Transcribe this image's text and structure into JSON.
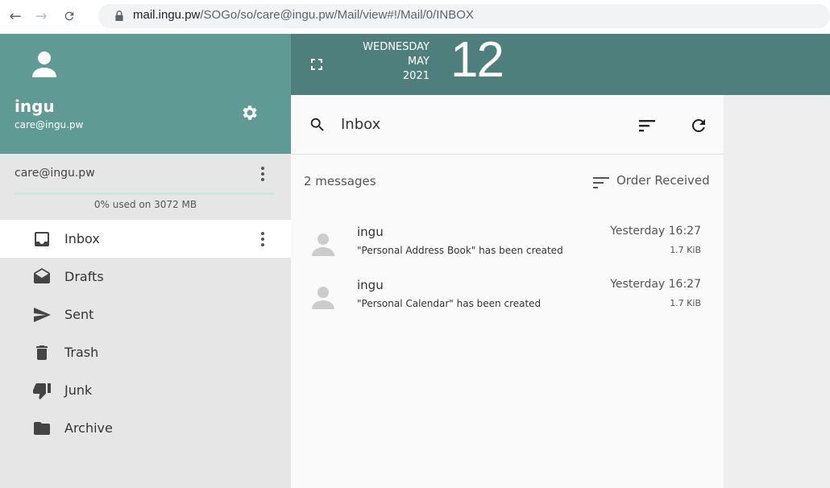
{
  "browser": {
    "url_host": "mail.ingu.pw",
    "url_path": "/SOGo/so/care@ingu.pw/Mail/view#!/Mail/0/INBOX"
  },
  "user": {
    "name": "ingu",
    "email": "care@ingu.pw"
  },
  "account": {
    "label": "care@ingu.pw",
    "quota_text": "0% used on 3072 MB",
    "quota_fraction": 0
  },
  "folders": [
    {
      "label": "Inbox",
      "icon": "inbox-icon",
      "active": true
    },
    {
      "label": "Drafts",
      "icon": "drafts-icon",
      "active": false
    },
    {
      "label": "Sent",
      "icon": "send-icon",
      "active": false
    },
    {
      "label": "Trash",
      "icon": "trash-icon",
      "active": false
    },
    {
      "label": "Junk",
      "icon": "thumb-down-icon",
      "active": false
    },
    {
      "label": "Archive",
      "icon": "folder-icon",
      "active": false
    }
  ],
  "date": {
    "weekday": "WEDNESDAY",
    "month": "MAY",
    "year": "2021",
    "day": "12"
  },
  "list": {
    "folder_title": "Inbox",
    "count_text": "2 messages",
    "order_label": "Order Received",
    "messages": [
      {
        "from": "ingu",
        "subject": "\"Personal Address Book\" has been created",
        "date": "Yesterday 16:27",
        "size": "1.7 KiB"
      },
      {
        "from": "ingu",
        "subject": "\"Personal Calendar\" has been created",
        "date": "Yesterday 16:27",
        "size": "1.7 KiB"
      }
    ]
  },
  "colors": {
    "header_teal": "#609a94",
    "topbar_teal": "#4e7f7c",
    "sidebar_bg": "#e6e6e6"
  }
}
